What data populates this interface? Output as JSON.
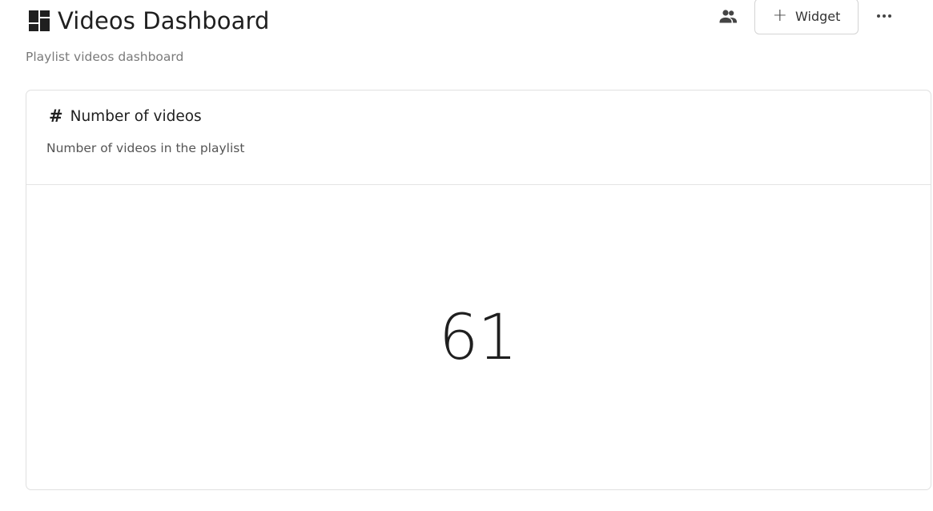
{
  "header": {
    "icon": "dashboard-icon",
    "title": "Videos Dashboard",
    "subtitle": "Playlist videos dashboard",
    "share_icon": "people-icon",
    "add_widget_label": "Widget",
    "add_widget_icon": "plus-icon",
    "more_icon": "more-horizontal-icon"
  },
  "widget": {
    "icon": "hash-icon",
    "icon_glyph": "#",
    "title": "Number of videos",
    "description": "Number of videos in the playlist",
    "value": "61"
  }
}
